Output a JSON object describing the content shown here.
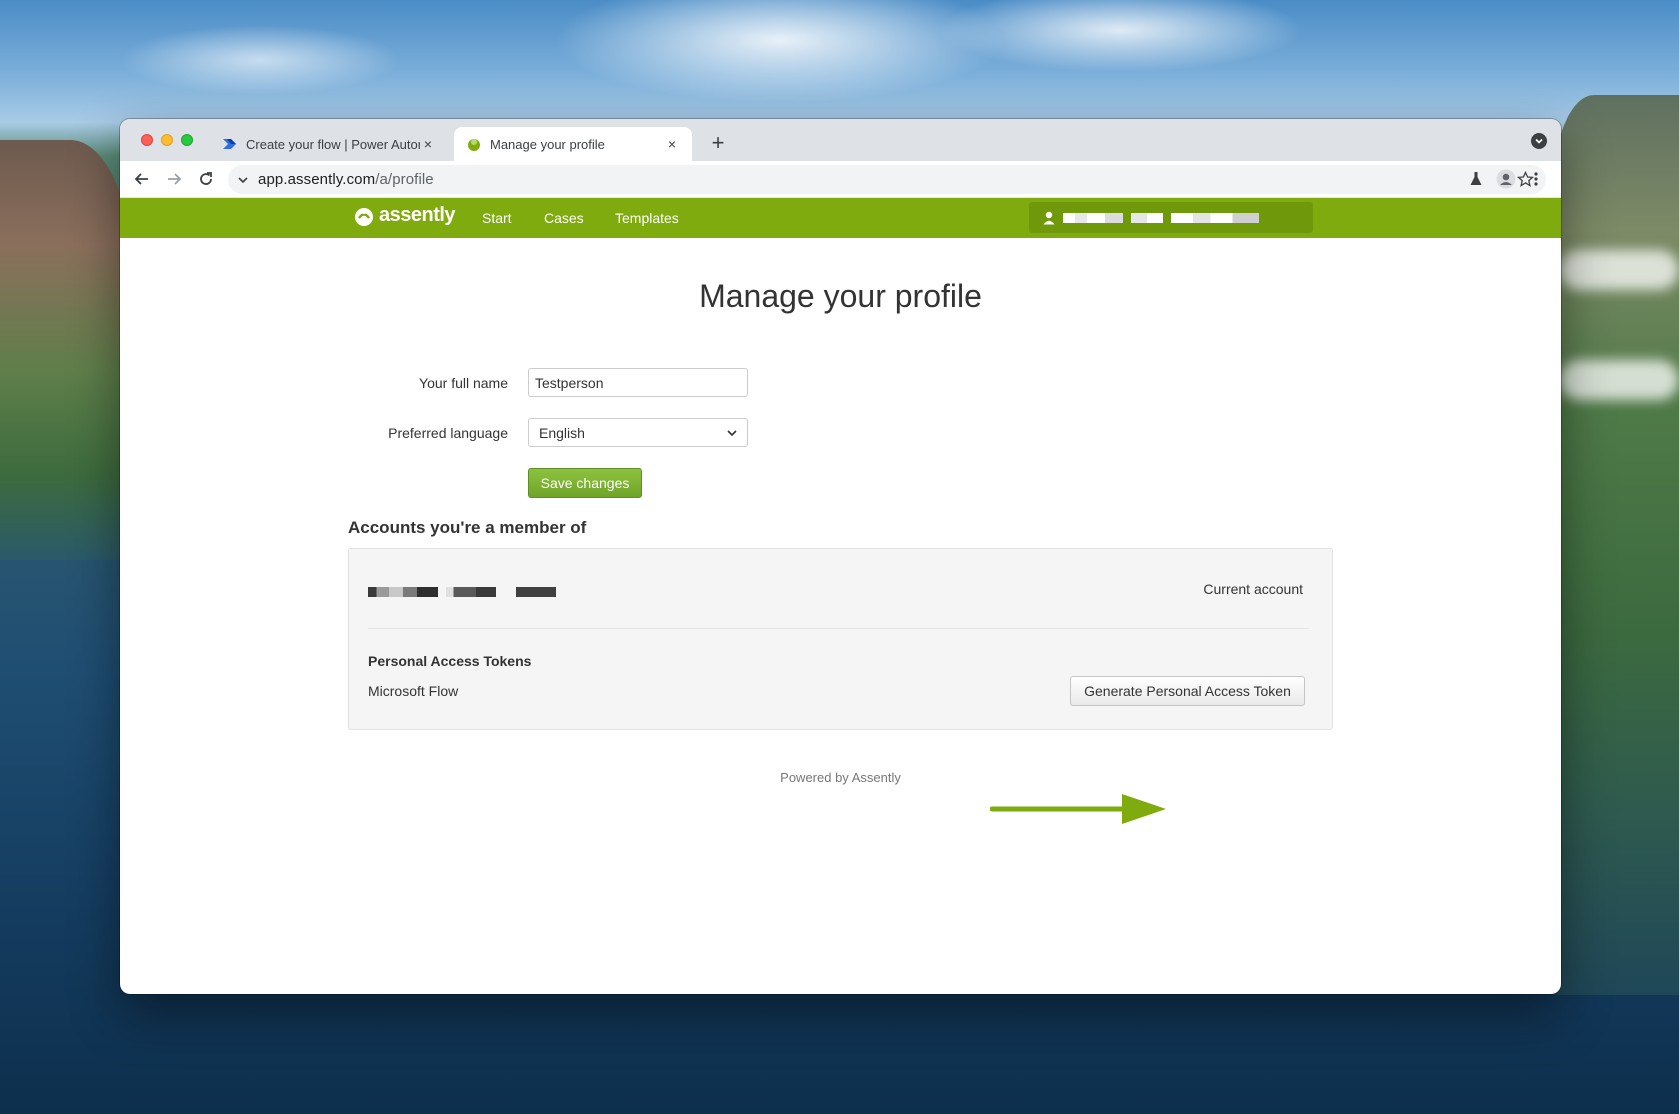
{
  "browser": {
    "tabs": [
      {
        "title": "Create your flow | Power Autom",
        "active": false
      },
      {
        "title": "Manage your profile",
        "active": true
      }
    ],
    "close_glyph": "×",
    "new_tab_glyph": "+",
    "url_host": "app.assently.com",
    "url_path": "/a/profile"
  },
  "app": {
    "brand": "assently",
    "nav": [
      "Start",
      "Cases",
      "Templates"
    ],
    "accent_color": "#7fab0e"
  },
  "page": {
    "title": "Manage your profile",
    "form": {
      "full_name_label": "Your full name",
      "full_name_value": "Testperson",
      "language_label": "Preferred language",
      "language_value": "English",
      "save_label": "Save changes"
    },
    "accounts": {
      "heading": "Accounts you're a member of",
      "current_account_label": "Current account",
      "pat_title": "Personal Access Tokens",
      "pat_item": "Microsoft Flow",
      "generate_label": "Generate Personal Access Token"
    },
    "footer": "Powered by Assently"
  }
}
